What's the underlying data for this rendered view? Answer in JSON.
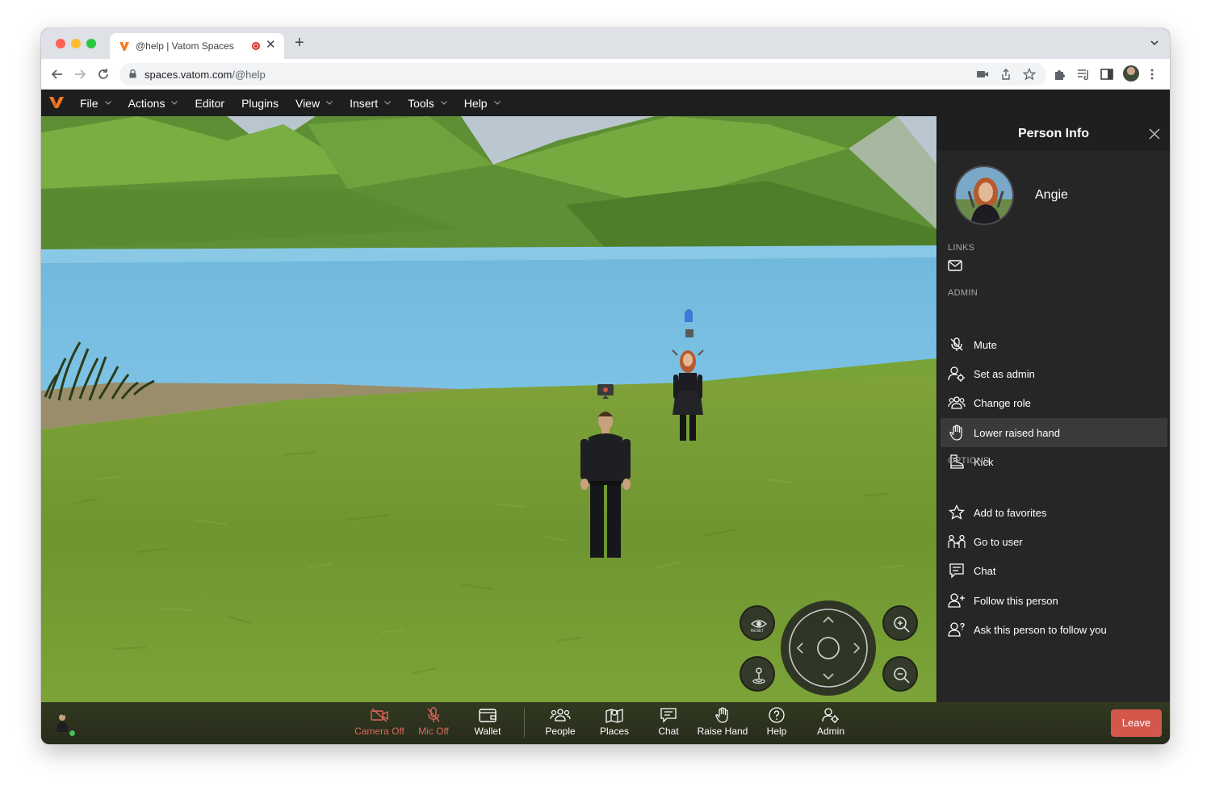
{
  "browser": {
    "tab_title": "@help | Vatom Spaces",
    "url_host": "spaces.vatom.com",
    "url_path": "/@help",
    "new_tab_symbol": "+",
    "close_symbol": "✕"
  },
  "menu": {
    "items": [
      {
        "label": "File",
        "has_dropdown": true
      },
      {
        "label": "Actions",
        "has_dropdown": true
      },
      {
        "label": "Editor",
        "has_dropdown": false
      },
      {
        "label": "Plugins",
        "has_dropdown": false
      },
      {
        "label": "View",
        "has_dropdown": true
      },
      {
        "label": "Insert",
        "has_dropdown": true
      },
      {
        "label": "Tools",
        "has_dropdown": true
      },
      {
        "label": "Help",
        "has_dropdown": true
      }
    ]
  },
  "panel": {
    "title": "Person Info",
    "person_name": "Angie",
    "links_label": "LINKS",
    "admin_label": "ADMIN",
    "options_label": "OPTIONS",
    "admin_items": [
      {
        "label": "Mute",
        "icon": "mic-off-icon"
      },
      {
        "label": "Set as admin",
        "icon": "user-gear-icon"
      },
      {
        "label": "Change role",
        "icon": "users-group-icon"
      },
      {
        "label": "Lower raised hand",
        "icon": "hand-icon"
      },
      {
        "label": "Kick",
        "icon": "boot-icon"
      }
    ],
    "option_items": [
      {
        "label": "Add to favorites",
        "icon": "star-icon"
      },
      {
        "label": "Go to user",
        "icon": "go-to-user-icon"
      },
      {
        "label": "Chat",
        "icon": "chat-icon"
      },
      {
        "label": "Follow this person",
        "icon": "user-plus-icon"
      },
      {
        "label": "Ask this person to follow you",
        "icon": "user-question-icon"
      }
    ]
  },
  "scene_controls": {
    "reset_label": "RESET"
  },
  "bottombar": {
    "camera": "Camera Off",
    "mic": "Mic Off",
    "wallet": "Wallet",
    "people": "People",
    "places": "Places",
    "chat": "Chat",
    "raise_hand": "Raise Hand",
    "help": "Help",
    "admin": "Admin",
    "leave": "Leave"
  },
  "colors": {
    "off_state": "#e0655a",
    "leave_button": "#d4574c",
    "online_status": "#47c25a",
    "brand_orange": "#f47b20"
  }
}
